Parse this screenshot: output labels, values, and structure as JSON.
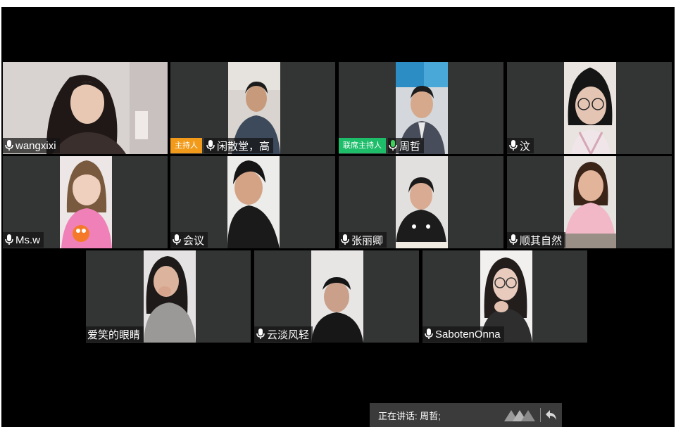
{
  "participants": [
    {
      "name": "wangxixi",
      "mic": true,
      "role": ""
    },
    {
      "name": "闲散堂，高",
      "mic": true,
      "role": "主持人"
    },
    {
      "name": "周哲",
      "mic": true,
      "role": "联席主持人",
      "speaking": true
    },
    {
      "name": "汶",
      "mic": true,
      "role": ""
    },
    {
      "name": "Ms.w",
      "mic": true,
      "role": ""
    },
    {
      "name": "会议",
      "mic": true,
      "role": ""
    },
    {
      "name": "张丽卿",
      "mic": true,
      "role": ""
    },
    {
      "name": "顺其自然",
      "mic": true,
      "role": ""
    },
    {
      "name": "爱笑的眼睛",
      "mic": false,
      "role": ""
    },
    {
      "name": "云淡风轻",
      "mic": true,
      "role": ""
    },
    {
      "name": "SabotenOnna",
      "mic": true,
      "role": ""
    }
  ],
  "status": {
    "speaking_label": "正在讲话: 周哲;"
  },
  "colors": {
    "host_badge": "#f29b1b",
    "cohost_badge": "#1dbd6a",
    "active_mic": "#3cd25a",
    "tile_bg": "#333434"
  }
}
